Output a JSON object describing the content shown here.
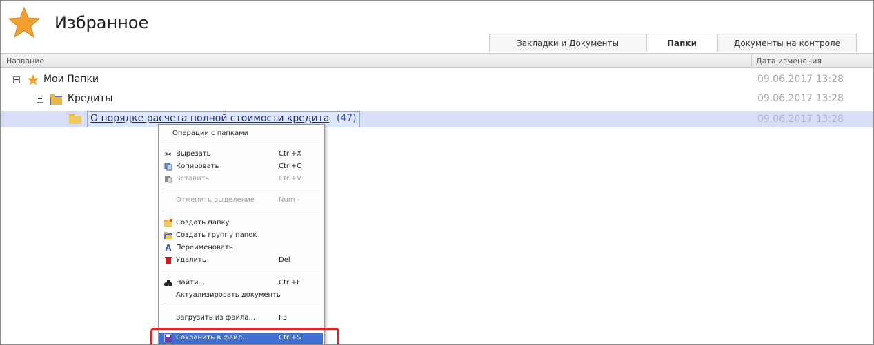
{
  "header": {
    "title": "Избранное"
  },
  "tabs": [
    {
      "label": "Закладки и Документы"
    },
    {
      "label": "Папки"
    },
    {
      "label": "Документы на контроле"
    }
  ],
  "columns": {
    "name": "Название",
    "date": "Дата изменения"
  },
  "rows": [
    {
      "label": "Мои Папки",
      "date": "09.06.2017 13:28"
    },
    {
      "label": "Кредиты",
      "date": "09.06.2017 13:28"
    },
    {
      "label": "О порядке расчета полной стоимости кредита",
      "count": "(47)",
      "date": "09.06.2017 13:28"
    }
  ],
  "context_menu": {
    "header": "Операции с папками",
    "items": [
      {
        "label": "Вырезать",
        "shortcut": "Ctrl+X"
      },
      {
        "label": "Копировать",
        "shortcut": "Ctrl+C"
      },
      {
        "label": "Вставить",
        "shortcut": "Ctrl+V"
      },
      {
        "label": "Отменить выделение",
        "shortcut": "Num -"
      },
      {
        "label": "Создать папку",
        "shortcut": ""
      },
      {
        "label": "Создать группу папок",
        "shortcut": ""
      },
      {
        "label": "Переименовать",
        "shortcut": ""
      },
      {
        "label": "Удалить",
        "shortcut": "Del"
      },
      {
        "label": "Найти...",
        "shortcut": "Ctrl+F"
      },
      {
        "label": "Актуализировать документы",
        "shortcut": ""
      },
      {
        "label": "Загрузить из файла...",
        "shortcut": "F3"
      },
      {
        "label": "Сохранить в файл...",
        "shortcut": "Ctrl+S"
      }
    ]
  },
  "colors": {
    "accent": "#3f6fd0",
    "highlight_border": "#d62a2a",
    "star": "#f0a030",
    "folder": "#e8b84a"
  }
}
